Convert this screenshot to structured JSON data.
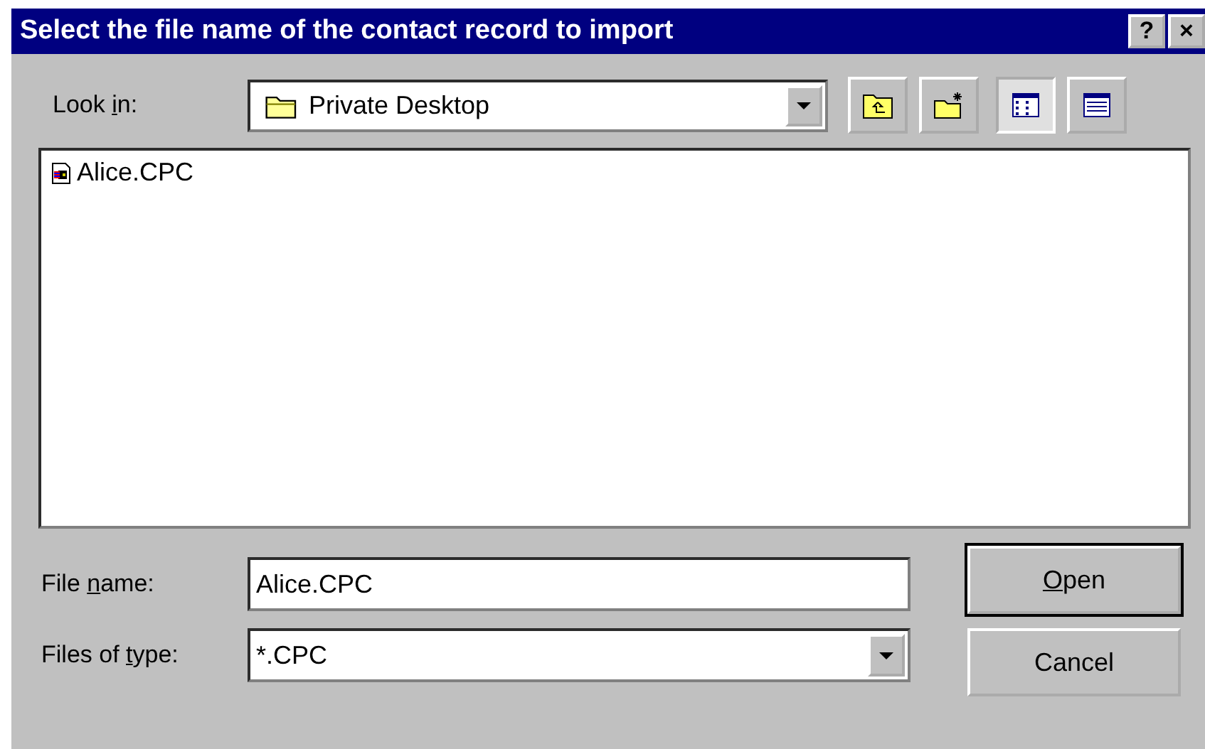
{
  "window": {
    "title": "Select the file name of the contact record to import",
    "title_buttons": [
      "?",
      "×"
    ]
  },
  "look_in": {
    "label": {
      "before": "Look ",
      "key": "i",
      "after": "n:"
    },
    "value": "Private Desktop"
  },
  "toolbar": [
    {
      "kind": "up",
      "selected": false
    },
    {
      "kind": "newfolder",
      "selected": false
    },
    {
      "kind": "list",
      "selected": true
    },
    {
      "kind": "details",
      "selected": false
    }
  ],
  "files": [
    {
      "name": "Alice.CPC",
      "selected": false
    }
  ],
  "file_name": {
    "label": {
      "before": "File ",
      "key": "n",
      "after": "ame:"
    },
    "value": "Alice.CPC"
  },
  "file_type": {
    "label": {
      "before": "Files of ",
      "key": "t",
      "after": "ype:"
    },
    "value": "*.CPC"
  },
  "buttons": [
    {
      "label": {
        "key": "O",
        "after": "pen"
      },
      "default": true
    },
    {
      "label": {
        "before": "Cancel"
      },
      "default": false
    }
  ]
}
